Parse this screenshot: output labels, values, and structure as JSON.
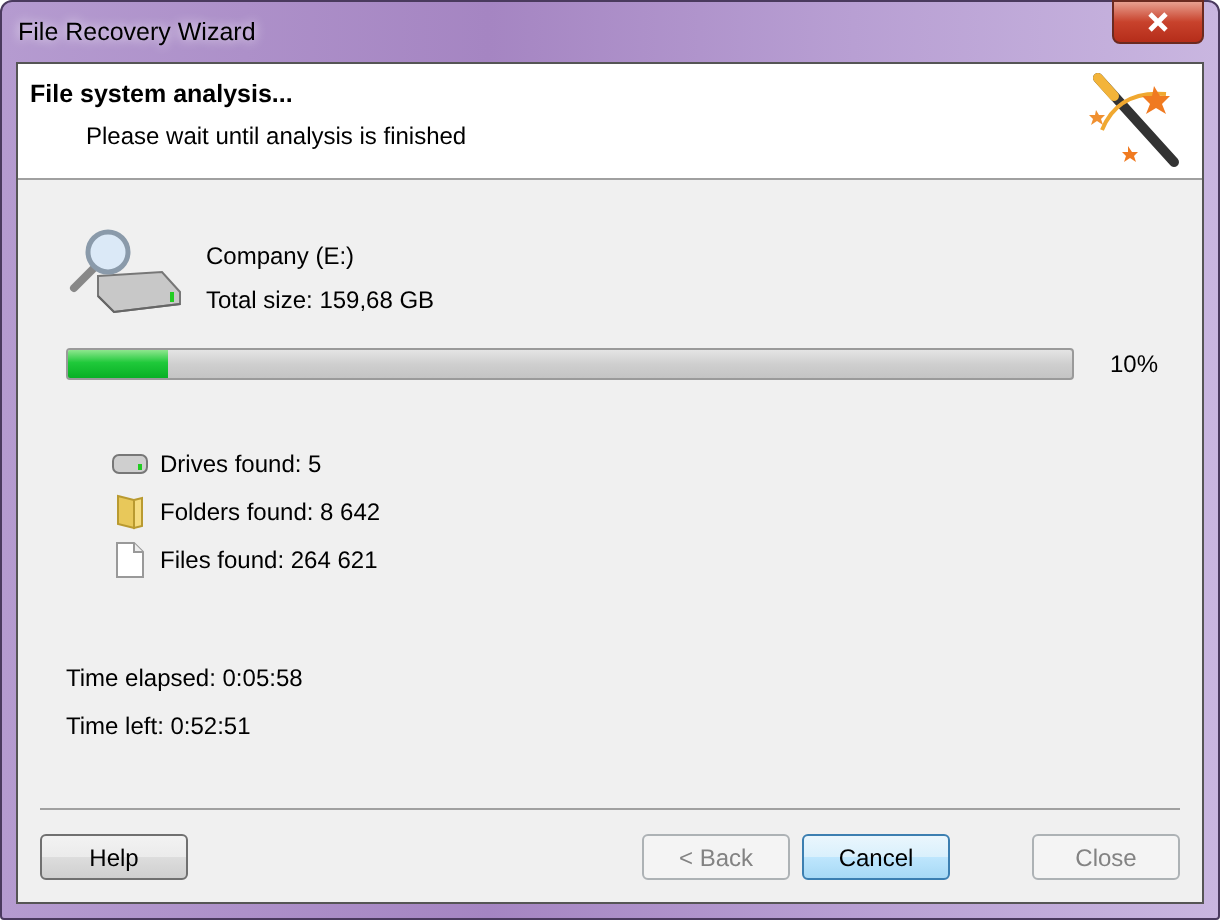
{
  "window": {
    "title": "File Recovery Wizard"
  },
  "header": {
    "title": "File system analysis...",
    "subtitle": "Please wait until analysis is finished"
  },
  "drive": {
    "name": "Company (E:)",
    "total_size": "Total size: 159,68 GB"
  },
  "progress": {
    "level": 0.1,
    "reading": "10%"
  },
  "stats": [
    {
      "kind": "drive",
      "label": "Drives found: 5"
    },
    {
      "kind": "folder",
      "label": "Folders found: 8 642"
    },
    {
      "kind": "file",
      "label": "Files found: 264 621"
    }
  ],
  "times": [
    "Time elapsed: 0:05:58",
    "Time left: 0:52:51"
  ],
  "buttons": [
    {
      "label": "Help",
      "disabled": false,
      "focused": false
    },
    {
      "label": "< Back",
      "disabled": true,
      "focused": false
    },
    {
      "label": "Cancel",
      "disabled": false,
      "focused": true
    },
    {
      "label": "Close",
      "disabled": true,
      "focused": false
    }
  ]
}
